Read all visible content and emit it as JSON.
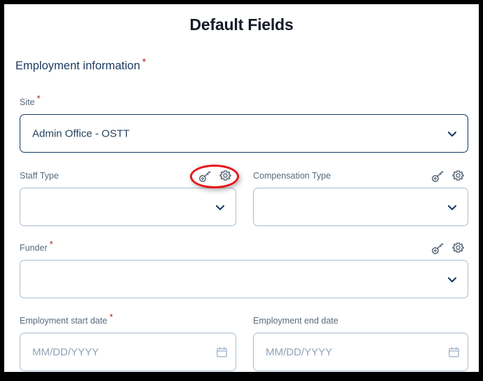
{
  "window": {
    "title": "Default Fields",
    "border_color": "#000000",
    "background": "#ffffff"
  },
  "colors": {
    "title_text": "#151b28",
    "heading_text": "#1b3b5f",
    "label_text": "#5a6b7d",
    "value_text": "#28435f",
    "placeholder_text": "#8fa3b8",
    "field_border": "#a9bdd1",
    "field_border_focused": "#153a62",
    "required_asterisk": "#b3201f",
    "annotation_red": "#e8161a",
    "icon_color": "#4f5e71"
  },
  "form": {
    "section": {
      "heading": "Employment information",
      "required": true,
      "required_marker": "*"
    },
    "fields": [
      {
        "id": "site",
        "label": "Site",
        "required": true,
        "type": "select",
        "value": "Admin Office - OSTT",
        "placeholder": "",
        "focused": true,
        "full_width": true,
        "icons": []
      },
      {
        "id": "staff-type",
        "label": "Staff Type",
        "required": false,
        "type": "select",
        "value": "",
        "placeholder": "",
        "focused": false,
        "full_width": false,
        "column": "left",
        "icons": [
          "key-icon",
          "gear-icon"
        ],
        "annotated": true
      },
      {
        "id": "compensation-type",
        "label": "Compensation Type",
        "required": false,
        "type": "select",
        "value": "",
        "placeholder": "",
        "focused": false,
        "full_width": false,
        "column": "right",
        "icons": [
          "key-icon",
          "gear-icon"
        ]
      },
      {
        "id": "funder",
        "label": "Funder",
        "required": true,
        "type": "select",
        "value": "",
        "placeholder": "",
        "focused": false,
        "full_width": true,
        "icons": [
          "key-icon",
          "gear-icon"
        ]
      },
      {
        "id": "employment-start-date",
        "label": "Employment start date",
        "required": true,
        "type": "date",
        "value": "",
        "placeholder": "MM/DD/YYYY",
        "focused": false,
        "full_width": false,
        "column": "left",
        "icons": [
          "calendar-icon"
        ]
      },
      {
        "id": "employment-end-date",
        "label": "Employment end date",
        "required": false,
        "type": "date",
        "value": "",
        "placeholder": "MM/DD/YYYY",
        "focused": false,
        "full_width": false,
        "column": "right",
        "icons": [
          "calendar-icon"
        ]
      }
    ]
  },
  "annotation": {
    "type": "ellipse-highlight",
    "color": "#e8161a",
    "targets": [
      "key-icon",
      "gear-icon"
    ],
    "near_field": "Staff Type"
  }
}
